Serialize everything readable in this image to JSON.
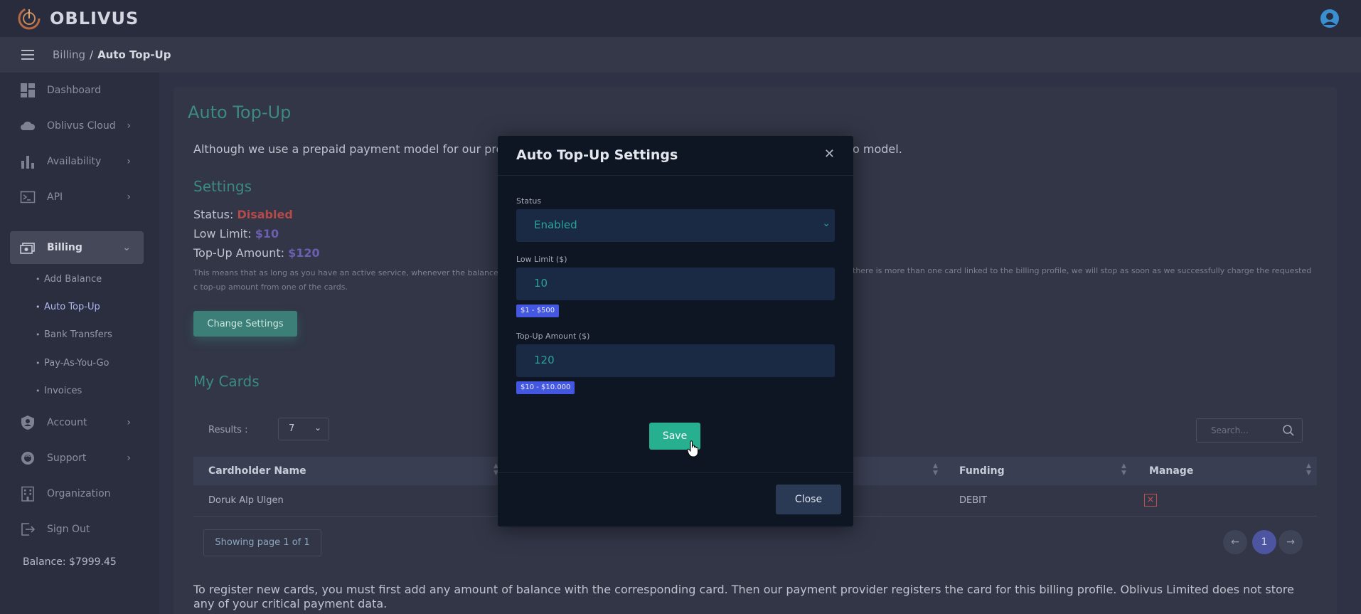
{
  "app": {
    "name": "OBLIVUS"
  },
  "breadcrumb": {
    "parent": "Billing",
    "separator": "/",
    "current": "Auto Top-Up"
  },
  "sidebar": {
    "items": [
      {
        "label": "Dashboard",
        "icon": "dashboard-icon"
      },
      {
        "label": "Oblivus Cloud",
        "icon": "cloud-icon"
      },
      {
        "label": "Availability",
        "icon": "bar-chart-icon"
      },
      {
        "label": "API",
        "icon": "terminal-icon"
      },
      {
        "label": "Billing",
        "icon": "billing-icon"
      },
      {
        "label": "Account",
        "icon": "shield-icon"
      },
      {
        "label": "Support",
        "icon": "support-icon"
      },
      {
        "label": "Organization",
        "icon": "building-icon"
      },
      {
        "label": "Sign Out",
        "icon": "sign-out-icon"
      }
    ],
    "billing_sub": [
      "Add Balance",
      "Auto Top-Up",
      "Bank Transfers",
      "Pay-As-You-Go",
      "Invoices"
    ],
    "balance": "Balance: $7999.45"
  },
  "page": {
    "title": "Auto Top-Up",
    "intro": "Although we use a prepaid payment model for our produ",
    "intro_tail": "o model.",
    "settings_title": "Settings",
    "status_label": "Status:",
    "status_value": "Disabled",
    "low_label": "Low Limit:",
    "low_value": "$10",
    "topup_label": "Top-Up Amount:",
    "topup_value": "$120",
    "fine_left": "This means that as long as you have an active service, whenever the balance c top-up amount from one of the cards.",
    "fine_right": "there is more than one card linked to the billing profile, we will stop as soon as we successfully charge the requested",
    "change_button": "Change Settings",
    "cards_title": "My Cards",
    "results_label": "Results :",
    "results_value": "7",
    "search_placeholder": "Search...",
    "table": {
      "headers": [
        "Cardholder Name",
        "Funding",
        "Manage"
      ],
      "rows": [
        {
          "name": "Doruk Alp Ulgen",
          "funding": "DEBIT"
        }
      ]
    },
    "page_info": "Showing page 1 of 1",
    "current_page": "1",
    "bottom_note": "To register new cards, you must first add any amount of balance with the corresponding card. Then our payment provider registers the card for this billing profile. Oblivus Limited does not store any of your critical payment data."
  },
  "modal": {
    "title": "Auto Top-Up Settings",
    "status_label": "Status",
    "status_value": "Enabled",
    "low_label": "Low Limit ($)",
    "low_value": "10",
    "low_hint": "$1 - $500",
    "topup_label": "Top-Up Amount ($)",
    "topup_value": "120",
    "topup_hint": "$10 - $10.000",
    "save": "Save",
    "close": "Close"
  },
  "colors": {
    "accent": "#27b08f",
    "danger": "#b54a4a",
    "hint": "#4457e0"
  }
}
